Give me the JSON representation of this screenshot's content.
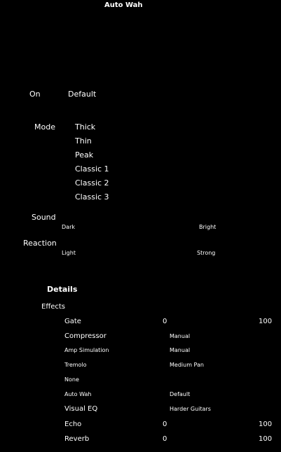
{
  "window": {
    "title": "Auto Wah"
  },
  "controls": {
    "on_label": "On",
    "preset_label": "Default",
    "mode": {
      "label": "Mode",
      "options": [
        "Thick",
        "Thin",
        "Peak",
        "Classic 1",
        "Classic 2",
        "Classic 3"
      ]
    },
    "sound": {
      "label": "Sound",
      "min_label": "Dark",
      "max_label": "Bright"
    },
    "reaction": {
      "label": "Reaction",
      "min_label": "Light",
      "max_label": "Strong"
    }
  },
  "details": {
    "heading": "Details",
    "effects_label": "Effects",
    "effects": [
      {
        "name": "Gate",
        "value": "0",
        "max": "100"
      },
      {
        "name": "Compressor",
        "value": "Manual",
        "max": ""
      },
      {
        "name": "Amp Simulation",
        "value": "Manual",
        "max": ""
      },
      {
        "name": "Tremolo",
        "value": "Medium Pan",
        "max": ""
      },
      {
        "name": "None",
        "value": "",
        "max": ""
      },
      {
        "name": "Auto Wah",
        "value": "Default",
        "max": ""
      },
      {
        "name": "Visual EQ",
        "value": "Harder Guitars",
        "max": ""
      },
      {
        "name": "Echo",
        "value": "0",
        "max": "100"
      },
      {
        "name": "Reverb",
        "value": "0",
        "max": "100"
      }
    ]
  }
}
